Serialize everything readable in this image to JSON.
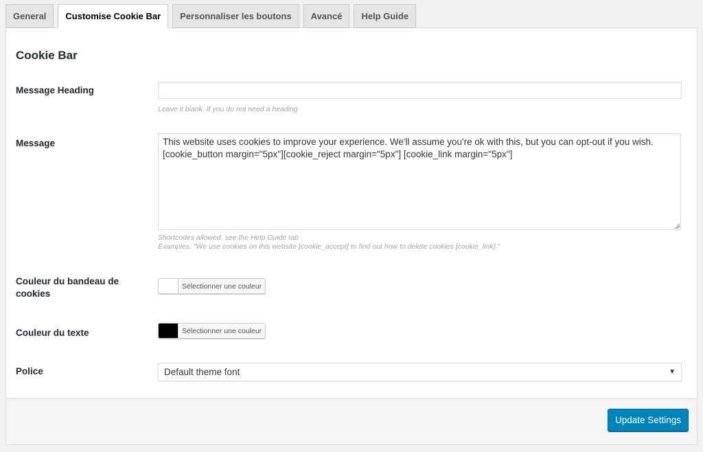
{
  "tabs": [
    {
      "label": "General",
      "active": false
    },
    {
      "label": "Customise Cookie Bar",
      "active": true
    },
    {
      "label": "Personnaliser les boutons",
      "active": false
    },
    {
      "label": "Avancé",
      "active": false
    },
    {
      "label": "Help Guide",
      "active": false
    }
  ],
  "section": {
    "title": "Cookie Bar"
  },
  "fields": {
    "message_heading": {
      "label": "Message Heading",
      "value": "",
      "hint": "Leave it blank, If you do not need a heading"
    },
    "message": {
      "label": "Message",
      "value": "This website uses cookies to improve your experience. We'll assume you're ok with this, but you can opt-out if you wish. [cookie_button margin=\"5px\"][cookie_reject margin=\"5px\"] [cookie_link margin=\"5px\"]",
      "hint_line1": "Shortcodes allowed: see the Help Guide tab",
      "hint_line2": "Examples: \"We use cookies on this website [cookie_accept] to find out how to delete cookies [cookie_link].\""
    },
    "bar_color": {
      "label": "Couleur du bandeau de cookies",
      "button_label": "Sélectionner une couleur",
      "color": "#ffffff"
    },
    "text_color": {
      "label": "Couleur du texte",
      "button_label": "Sélectionner une couleur",
      "color": "#000000"
    },
    "font": {
      "label": "Police",
      "selected": "Default theme font"
    }
  },
  "footer": {
    "update_label": "Update Settings"
  },
  "colors": {
    "primary_button": "#0085ba",
    "page_background": "#f1f1f1"
  }
}
